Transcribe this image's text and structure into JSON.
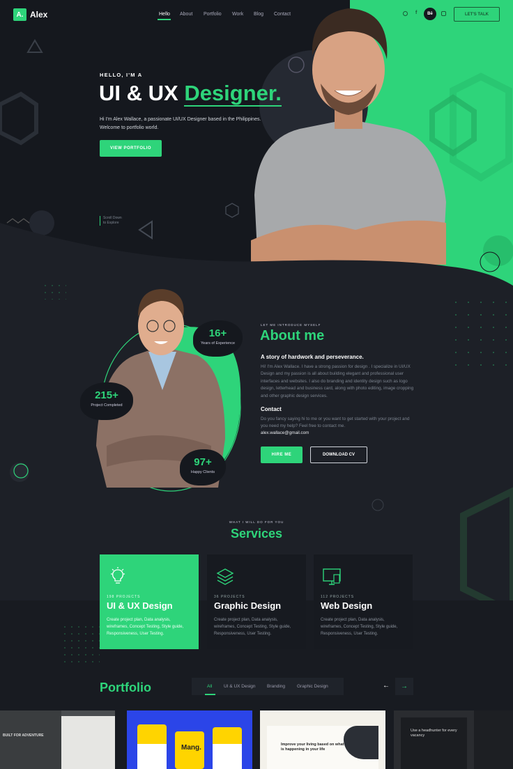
{
  "brand": {
    "logo_letter": "A.",
    "name": "Alex"
  },
  "nav": {
    "items": [
      "Hello",
      "About",
      "Portfolio",
      "Work",
      "Blog",
      "Contact"
    ],
    "active": "Hello",
    "cta": "LET'S TALK",
    "social_icons": [
      "dribbble-icon",
      "facebook-icon",
      "behance-icon",
      "instagram-icon"
    ],
    "behance_label": "Bē"
  },
  "hero": {
    "greeting": "HELLO, I'M A",
    "title_white": "UI & UX",
    "title_green": "Designer.",
    "intro": "Hi I'm Alex Wallace, a passionate UI/UX Designer based in the Philippines. Welcome to portfolio world.",
    "button": "VIEW PORTFOLIO",
    "scroll_line1": "Scroll Down",
    "scroll_line2": "to Explore"
  },
  "about": {
    "eyebrow": "LET ME INTRODUCE MYSELF",
    "title": "About me",
    "subtitle": "A story of hardwork and perseverance.",
    "body": "Hi! I'm Alex Wallace. I have a strong passion for design . I specialize in UI/UX Design and my passion is all about building elegant and professional user interfaces and websites. I also do branding and identity design such as logo design, letterhead and business card, along with photo editing, image cropping and other graphic design services.",
    "contact_heading": "Contact",
    "contact_body": "Do you fancy saying hi to me or you want to get started with your project and you need my help? Feel free to contact me.",
    "email": "alex.wallace@gmail.com",
    "hire_button": "HIRE ME",
    "cv_button": "DOWNLOAD CV",
    "stats": [
      {
        "value": "16+",
        "label": "Years of Experience"
      },
      {
        "value": "215+",
        "label": "Project Completed"
      },
      {
        "value": "97+",
        "label": "Happy Clients"
      }
    ]
  },
  "services": {
    "eyebrow": "WHAT I WILL DO FOR YOU",
    "title": "Services",
    "cards": [
      {
        "projects": "198 PROJECTS",
        "title": "UI & UX Design",
        "desc": "Create project plan, Data analysis, wireframes, Concept Testing, Style guide, Responsiveness, User Testing.",
        "icon": "lightbulb-icon"
      },
      {
        "projects": "36 PROJECTS",
        "title": "Graphic Design",
        "desc": "Create project plan, Data analysis, wireframes, Concept Testing, Style guide, Responsiveness, User Testing.",
        "icon": "layers-icon"
      },
      {
        "projects": "112 PROJECTS",
        "title": "Web Design",
        "desc": "Create project plan, Data analysis, wireframes, Concept Testing, Style guide, Responsiveness, User Testing.",
        "icon": "monitor-icon"
      }
    ]
  },
  "portfolio": {
    "title": "Portfolio",
    "tabs": [
      "All",
      "UI & UX Design",
      "Branding",
      "Graphic Design"
    ],
    "active_tab": "All",
    "prev": "←",
    "next": "→",
    "thumbs": [
      {
        "caption": "BUILT FOR ADVENTURE"
      },
      {
        "caption": "Mang."
      },
      {
        "caption": "Improve your living based on what is happening in your life"
      },
      {
        "caption": "Use a headhunter for every vacancy"
      }
    ]
  },
  "colors": {
    "accent": "#2ed47a",
    "dark": "#15181e",
    "bg": "#1d2027"
  }
}
